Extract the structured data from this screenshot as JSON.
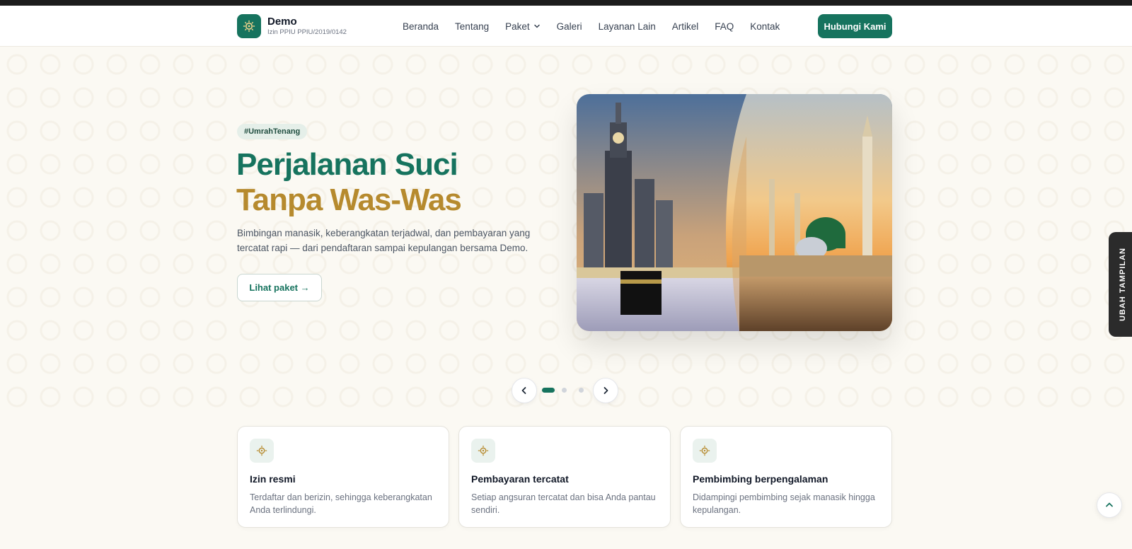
{
  "brand": {
    "name": "Demo",
    "license": "Izin PPIU PPIU/2019/0142",
    "icon": "sun-emblem-icon"
  },
  "nav": {
    "links": [
      "Beranda",
      "Tentang",
      "Paket",
      "Galeri",
      "Layanan Lain",
      "Artikel",
      "FAQ",
      "Kontak"
    ],
    "cta": "Hubungi Kami"
  },
  "hero": {
    "tag": "#UmrahTenang",
    "title_line1": "Perjalanan Suci",
    "title_line2": "Tanpa Was-Was",
    "description": "Bimbingan manasik, keberangkatan terjadwal, dan pembayaran yang tercatat rapi — dari pendaftaran sampai kepulangan bersama Demo.",
    "button": "Lihat paket →",
    "image": "mecca-and-medina-mosques-photo"
  },
  "side_tab": {
    "label": "UBAH TAMPILAN"
  },
  "carousel": {
    "slides": 3,
    "active": 1
  },
  "features": [
    {
      "title": "Izin resmi",
      "description": "Terdaftar dan berizin, sehingga keberangkatan Anda terlindungi."
    },
    {
      "title": "Pembayaran tercatat",
      "description": "Setiap angsuran tercatat dan bisa Anda pantau sendiri."
    },
    {
      "title": "Pembimbing berpengalaman",
      "description": "Didampingi pembimbing sejak manasik hingga kepulangan."
    }
  ],
  "colors": {
    "primary": "#16735e",
    "accent": "#b68a2e",
    "background": "#fbf9f3"
  }
}
